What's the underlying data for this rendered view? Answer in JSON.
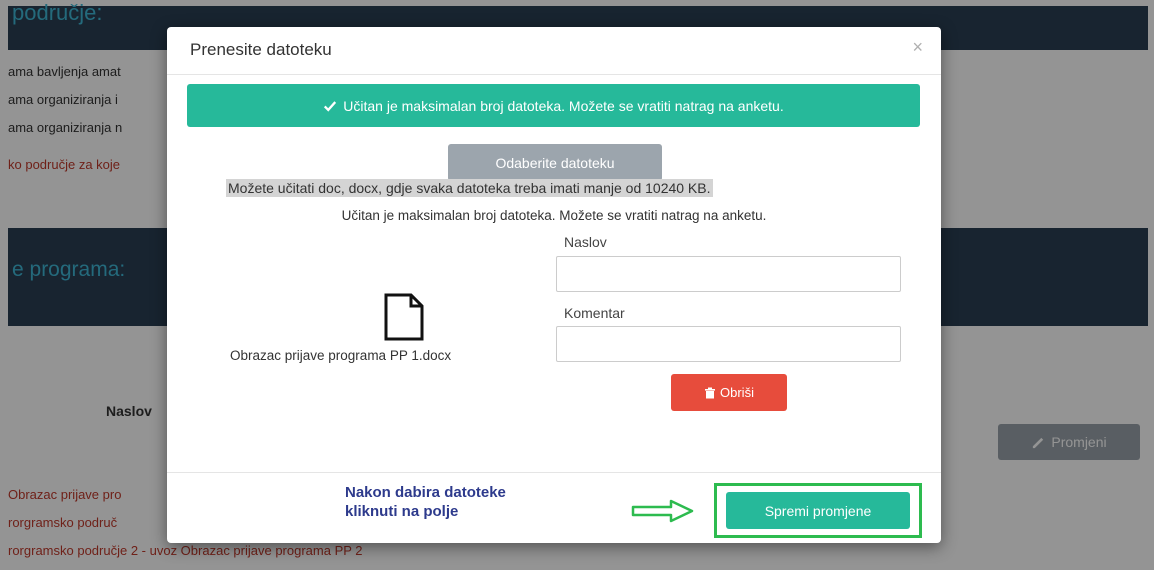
{
  "background": {
    "header_text": "područje:",
    "lines": [
      "ama bavljenja amat",
      "ama organiziranja i",
      "ama organiziranja n",
      "ko područje za koje"
    ],
    "section_title": "e programa:",
    "naslov_label": "Naslov",
    "promjeni_label": "Promjeni",
    "list_items": [
      "Obrazac prijave pro",
      "rorgramsko područ",
      "rorgramsko područje 2 - uvoz Obrazac prijave programa PP 2"
    ]
  },
  "modal": {
    "title": "Prenesite datoteku",
    "close_glyph": "×",
    "alert_text": "Učitan je maksimalan broj datoteka. Možete se vratiti natrag na anketu.",
    "choose_button": "Odaberite datoteku",
    "hint_text": "Možete učitati doc, docx, gdje svaka datoteka treba imati manje od 10240 KB.",
    "loaded_message": "Učitan je maksimalan broj datoteka. Možete se vratiti natrag na anketu.",
    "naslov_label": "Naslov",
    "naslov_value": "",
    "komentar_label": "Komentar",
    "komentar_value": "",
    "file_name": "Obrazac prijave programa PP 1.docx",
    "delete_button": "Obriši",
    "footer_instruction_line1": "Nakon dabira datoteke",
    "footer_instruction_line2": "kliknuti na polje",
    "save_button": "Spremi promjene"
  },
  "colors": {
    "alert": "#26b99a",
    "delete": "#e74c3c",
    "save": "#26b99a",
    "annotation": "#2dbb4f",
    "instruction_text": "#2d3a8c"
  },
  "icons": [
    "check-icon",
    "file-icon",
    "trash-icon",
    "pencil-icon",
    "arrow-right-icon",
    "close-icon"
  ]
}
